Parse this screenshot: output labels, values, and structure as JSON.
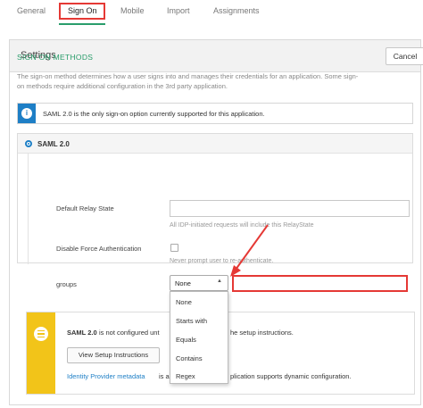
{
  "tabs": [
    {
      "label": "General"
    },
    {
      "label": "Sign On"
    },
    {
      "label": "Mobile"
    },
    {
      "label": "Import"
    },
    {
      "label": "Assignments"
    }
  ],
  "panel": {
    "title": "Settings",
    "cancel_label": "Cancel"
  },
  "sign_on_methods": {
    "heading": "SIGN ON METHODS",
    "description_line1": "The sign-on method determines how a user signs into and manages their credentials for an application. Some sign-",
    "description_line2": "on methods require additional configuration in the 3rd party application."
  },
  "info": {
    "icon": "info-icon",
    "text": "SAML 2.0 is the only sign-on option currently supported for this application."
  },
  "saml": {
    "label": "SAML 2.0",
    "relay_state_label": "Default Relay State",
    "relay_state_hint": "All IDP-initiated requests will include this RelayState",
    "force_auth_label": "Disable Force Authentication",
    "force_auth_hint": "Never prompt user to re-authenticate.",
    "groups_label": "groups",
    "groups_selected": "None",
    "groups_options": [
      "None",
      "Starts with",
      "Equals",
      "Contains",
      "Regex"
    ]
  },
  "warning": {
    "bold": "SAML 2.0",
    "text_before": " is not configured unt",
    "text_after": "he setup instructions.",
    "setup_button": "View Setup Instructions",
    "metadata_link": "Identity Provider metadata",
    "metadata_rest_a": " is a",
    "metadata_rest_b": "plication supports dynamic configuration."
  },
  "colors": {
    "accent_green": "#2a9d6b",
    "info_blue": "#1e7fc6",
    "highlight_red": "#e53935",
    "warning_yellow": "#f2c419"
  }
}
